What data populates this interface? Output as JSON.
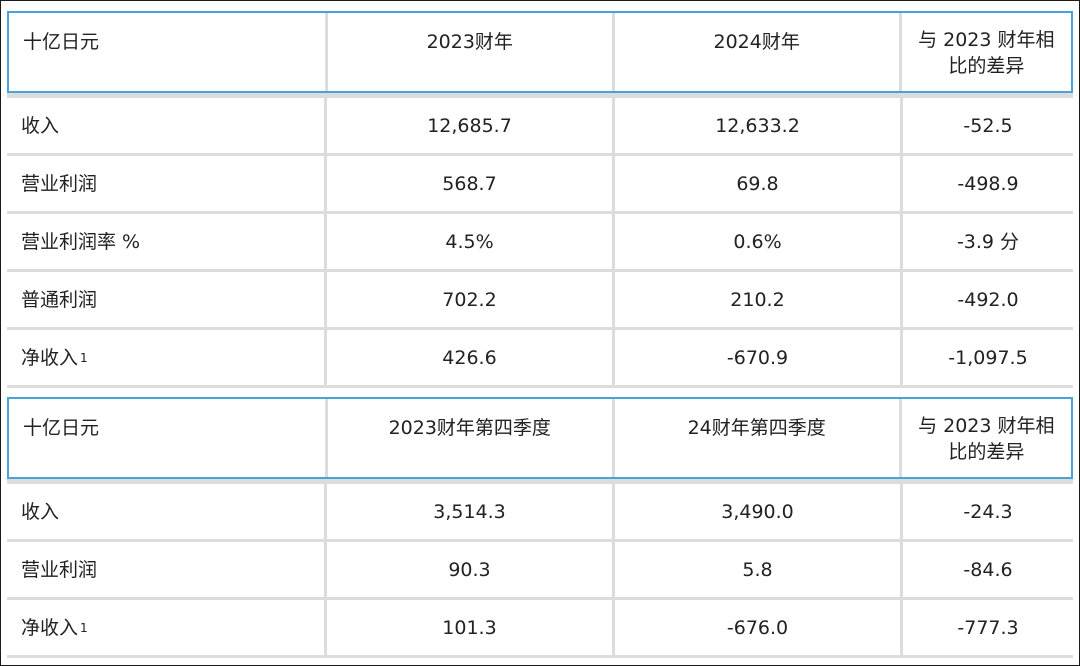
{
  "tables": [
    {
      "header": [
        "十亿日元",
        "2023财年",
        "2024财年",
        "与 2023 财年相比的差异"
      ],
      "rows": [
        {
          "label": "收入",
          "sup": "",
          "values": [
            "12,685.7",
            "12,633.2",
            "-52.5"
          ]
        },
        {
          "label": "营业利润",
          "sup": "",
          "values": [
            "568.7",
            "69.8",
            "-498.9"
          ]
        },
        {
          "label": "营业利润率 %",
          "sup": "",
          "values": [
            "4.5%",
            "0.6%",
            "-3.9 分"
          ]
        },
        {
          "label": "普通利润",
          "sup": "",
          "values": [
            "702.2",
            "210.2",
            "-492.0"
          ]
        },
        {
          "label": "净收入",
          "sup": "1",
          "values": [
            "426.6",
            "-670.9",
            "-1,097.5"
          ]
        }
      ]
    },
    {
      "header": [
        "十亿日元",
        "2023财年第四季度",
        "24财年第四季度",
        "与 2023 财年相比的差异"
      ],
      "rows": [
        {
          "label": "收入",
          "sup": "",
          "values": [
            "3,514.3",
            "3,490.0",
            "-24.3"
          ]
        },
        {
          "label": "营业利润",
          "sup": "",
          "values": [
            "90.3",
            "5.8",
            "-84.6"
          ]
        },
        {
          "label": "净收入",
          "sup": "1",
          "values": [
            "101.3",
            "-676.0",
            "-777.3"
          ]
        }
      ]
    }
  ],
  "colors": {
    "header_border": "#4aa3d8",
    "grid": "#dcdcdc",
    "frame": "#1a1a1a"
  }
}
